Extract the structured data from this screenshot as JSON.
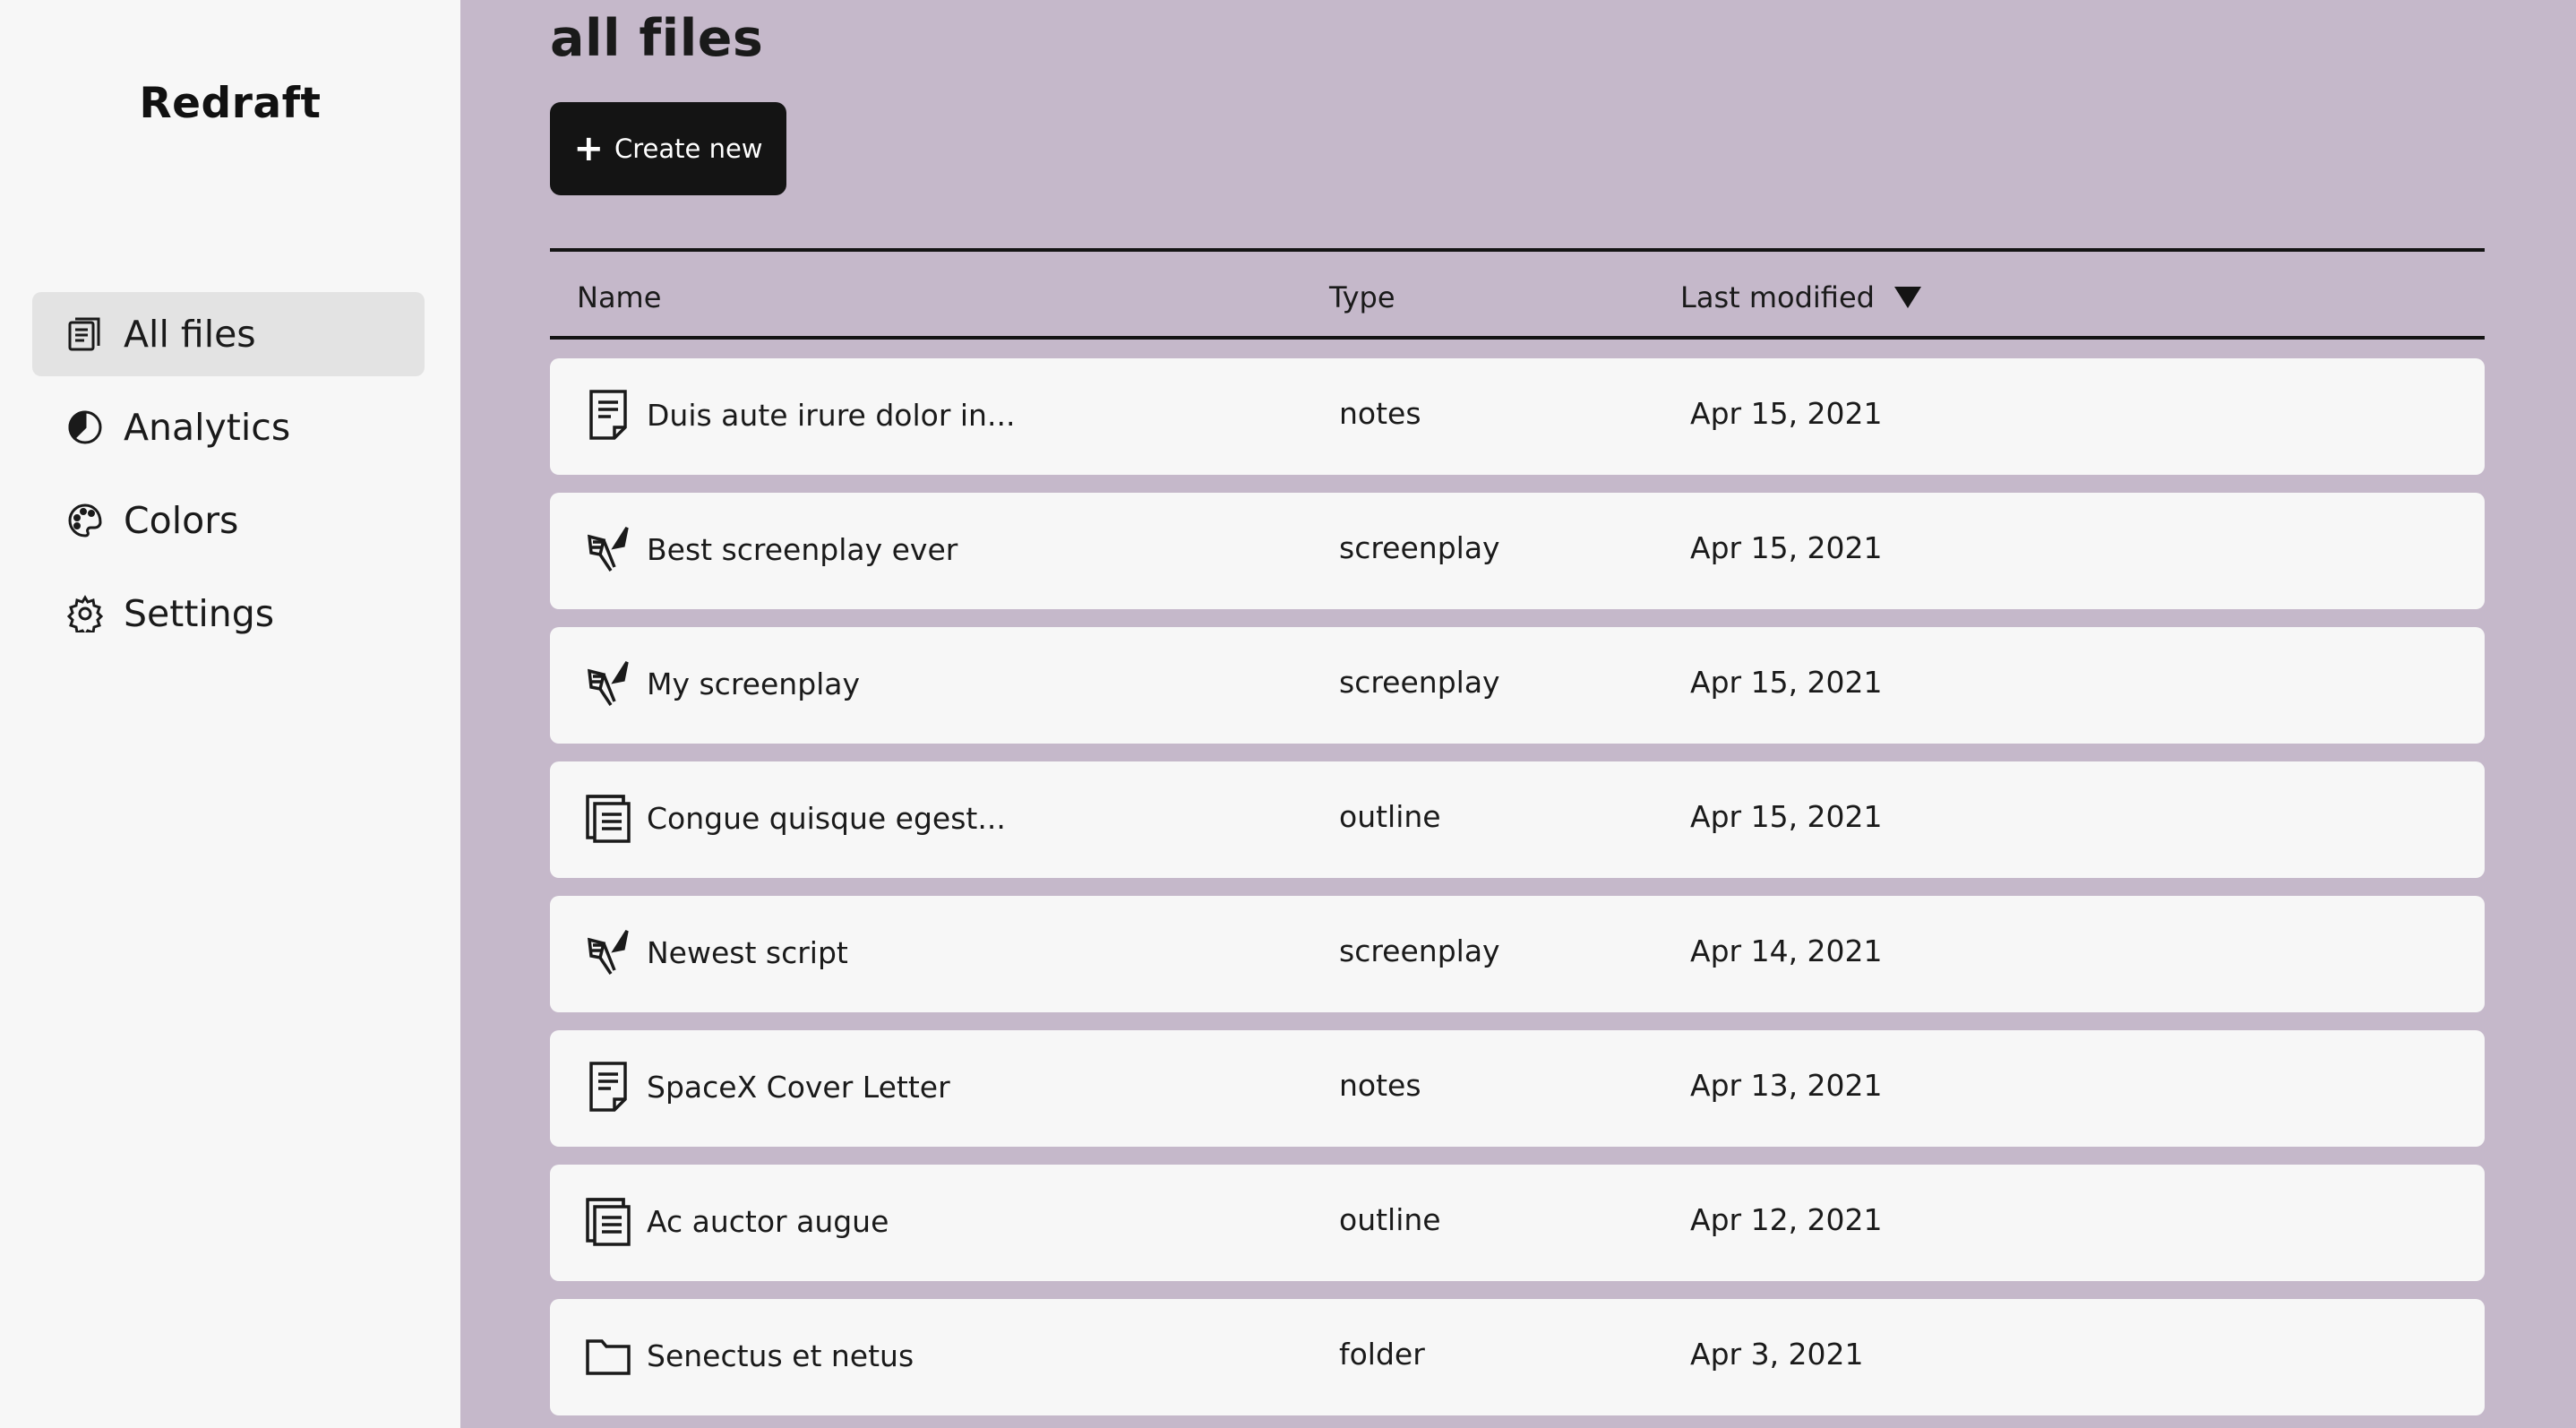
{
  "app": {
    "name": "Redraft"
  },
  "sidebar": {
    "items": [
      {
        "label": "All files",
        "icon": "files-icon",
        "active": true
      },
      {
        "label": "Analytics",
        "icon": "chart-pie-icon",
        "active": false
      },
      {
        "label": "Colors",
        "icon": "palette-icon",
        "active": false
      },
      {
        "label": "Settings",
        "icon": "gear-icon",
        "active": false
      }
    ]
  },
  "main": {
    "title": "all files",
    "create_button": {
      "label": "Create new",
      "icon": "plus-icon"
    },
    "columns": {
      "name": "Name",
      "type": "Type",
      "modified": "Last modified",
      "sort": "descending"
    },
    "files": [
      {
        "name": "Duis aute irure dolor in...",
        "type": "notes",
        "modified": "Apr 15, 2021",
        "icon": "notes-icon"
      },
      {
        "name": "Best screenplay ever",
        "type": "screenplay",
        "modified": "Apr 15, 2021",
        "icon": "screenplay-icon"
      },
      {
        "name": "My screenplay",
        "type": "screenplay",
        "modified": "Apr 15, 2021",
        "icon": "screenplay-icon"
      },
      {
        "name": "Congue quisque egest...",
        "type": "outline",
        "modified": "Apr 15, 2021",
        "icon": "outline-icon"
      },
      {
        "name": "Newest script",
        "type": "screenplay",
        "modified": "Apr 14, 2021",
        "icon": "screenplay-icon"
      },
      {
        "name": "SpaceX Cover Letter",
        "type": "notes",
        "modified": "Apr 13, 2021",
        "icon": "notes-icon"
      },
      {
        "name": "Ac auctor augue",
        "type": "outline",
        "modified": "Apr 12, 2021",
        "icon": "outline-icon"
      },
      {
        "name": "Senectus et netus",
        "type": "folder",
        "modified": "Apr 3, 2021",
        "icon": "folder-icon"
      }
    ]
  },
  "colors": {
    "background": "#c5b8ca",
    "sidebar": "#f7f7f7",
    "row": "#f7f7f7",
    "button": "#141414",
    "active_nav": "#e3e3e3"
  }
}
